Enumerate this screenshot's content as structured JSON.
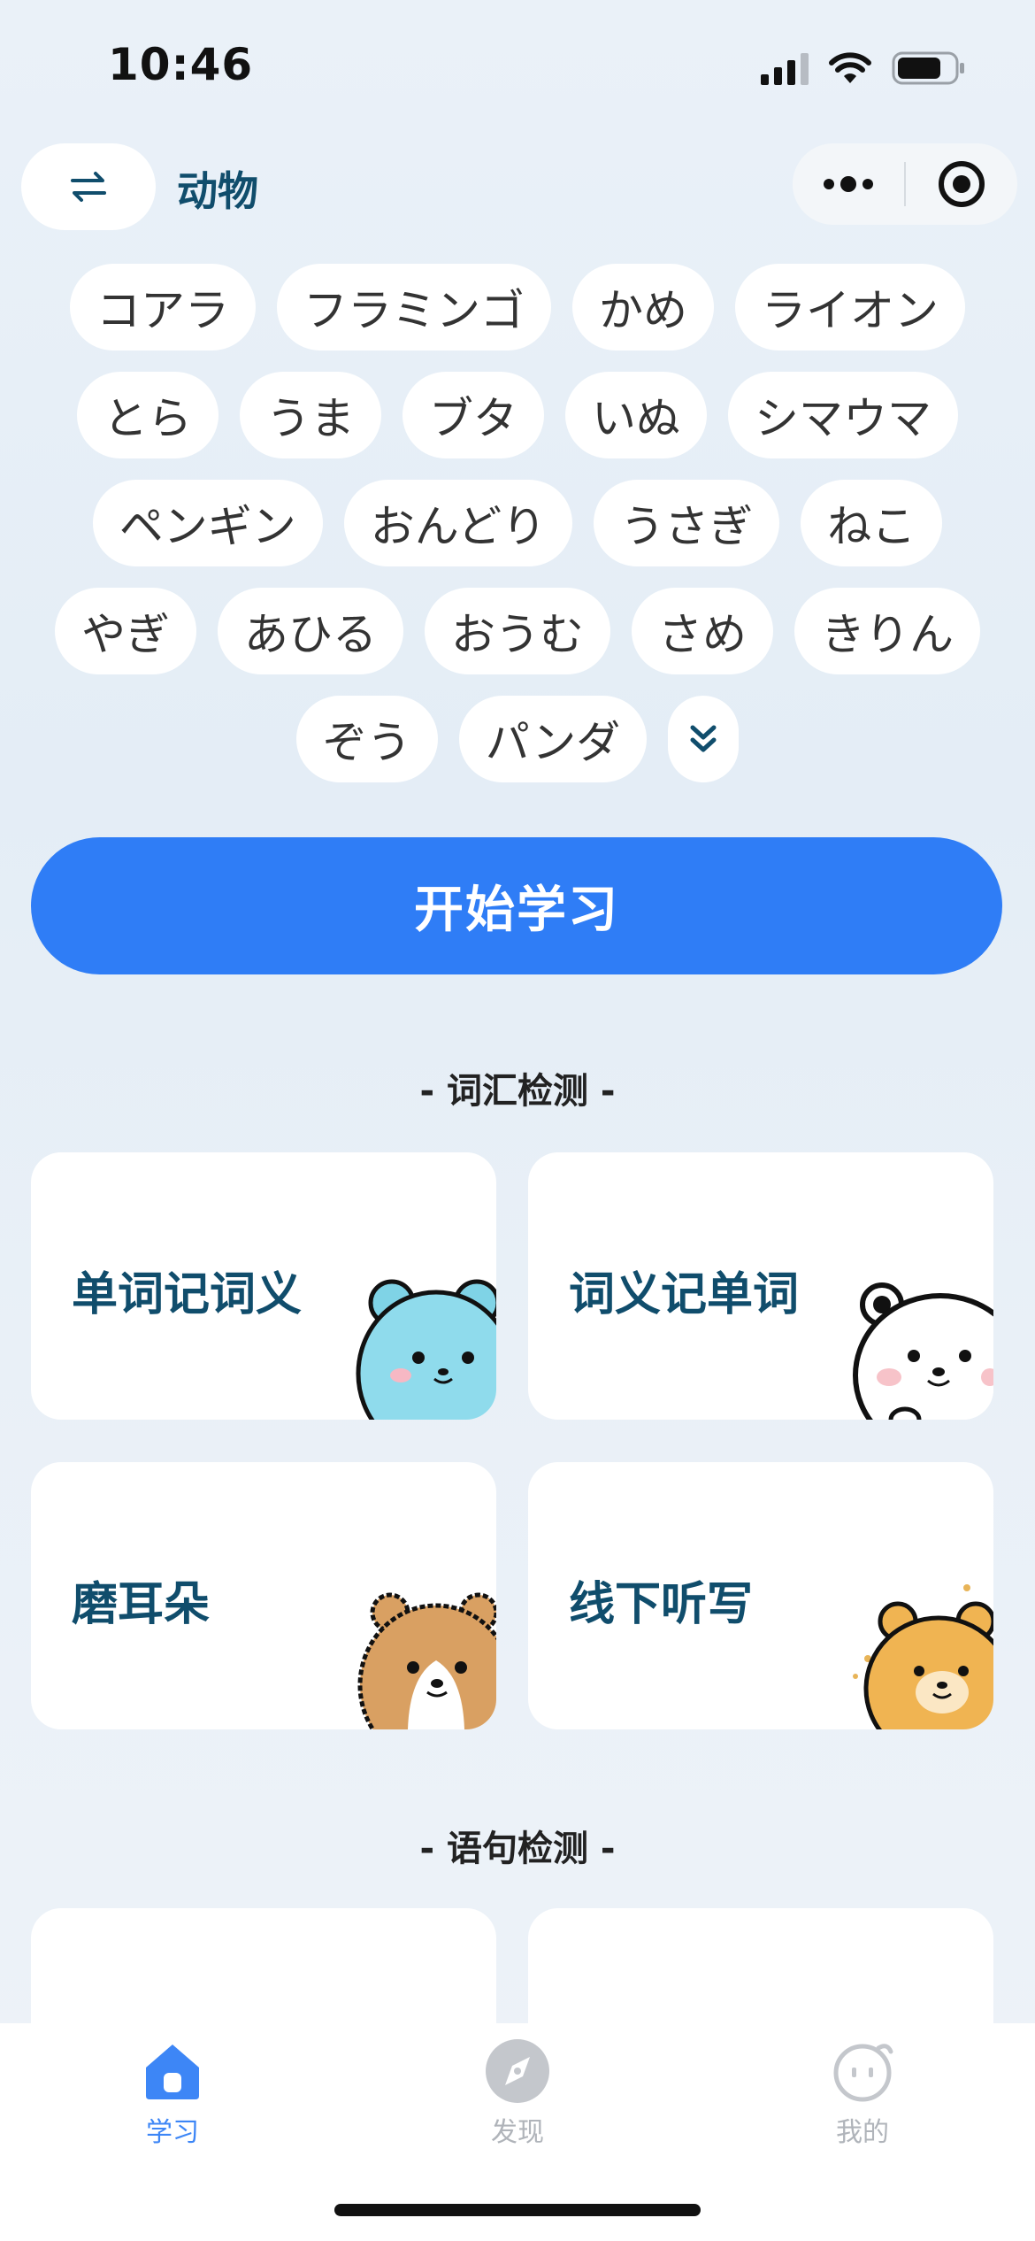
{
  "status": {
    "time": "10:46"
  },
  "nav": {
    "title": "动物",
    "swap_icon": "swap-arrows-icon",
    "more_icon": "more-dots-icon",
    "target_icon": "target-circle-icon"
  },
  "tags": [
    "コアラ",
    "フラミンゴ",
    "かめ",
    "ライオン",
    "とら",
    "うま",
    "ブタ",
    "いぬ",
    "シマウマ",
    "ペンギン",
    "おんどり",
    "うさぎ",
    "ねこ",
    "やぎ",
    "あひる",
    "おうむ",
    "さめ",
    "きりん",
    "ぞう",
    "パンダ"
  ],
  "start_label": "开始学习",
  "sections": {
    "vocab": "- 词汇检测 -",
    "sentence": "- 语句检测 -"
  },
  "cards": {
    "c1": "单词记词义",
    "c2": "词义记单词",
    "c3": "磨耳朵",
    "c4": "线下听写"
  },
  "tabs": [
    {
      "label": "学习",
      "icon": "home-icon",
      "active": true
    },
    {
      "label": "发现",
      "icon": "compass-icon",
      "active": false
    },
    {
      "label": "我的",
      "icon": "face-icon",
      "active": false
    }
  ],
  "colors": {
    "accent": "#2f7df6",
    "title": "#104d6c",
    "inactive": "#b0b4ba"
  }
}
